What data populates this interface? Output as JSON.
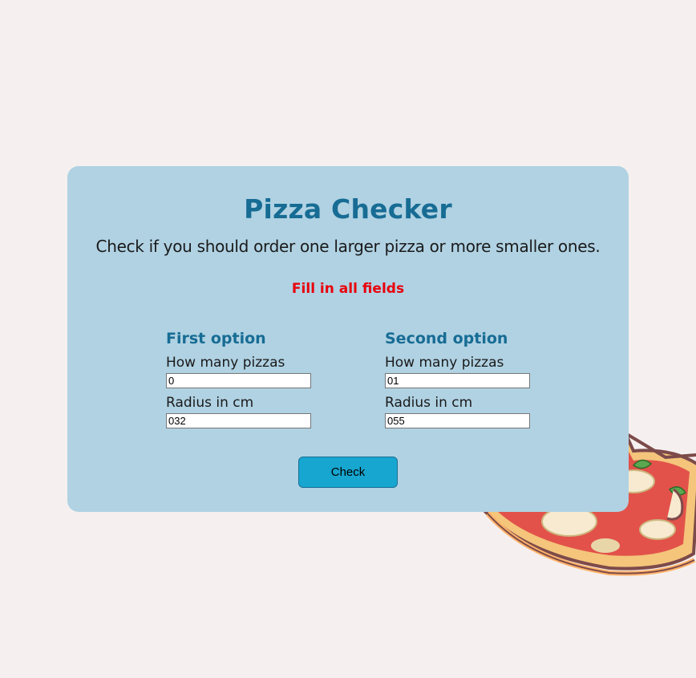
{
  "card": {
    "title": "Pizza Checker",
    "subtitle": "Check if you should order one larger pizza or more smaller ones.",
    "error": "Fill in all fields"
  },
  "options": [
    {
      "heading": "First option",
      "count_label": "How many pizzas",
      "count_value": "0",
      "radius_label": "Radius in cm",
      "radius_value": "032"
    },
    {
      "heading": "Second option",
      "count_label": "How many pizzas",
      "count_value": "01",
      "radius_label": "Radius in cm",
      "radius_value": "055"
    }
  ],
  "actions": {
    "check_label": "Check"
  },
  "colors": {
    "background": "#f5f0ef",
    "card": "#b0d2e3",
    "heading": "#176c94",
    "error": "#e8000b",
    "button": "#17a6cf"
  },
  "icons": {
    "decoration": "pizza-slice-illustration"
  }
}
